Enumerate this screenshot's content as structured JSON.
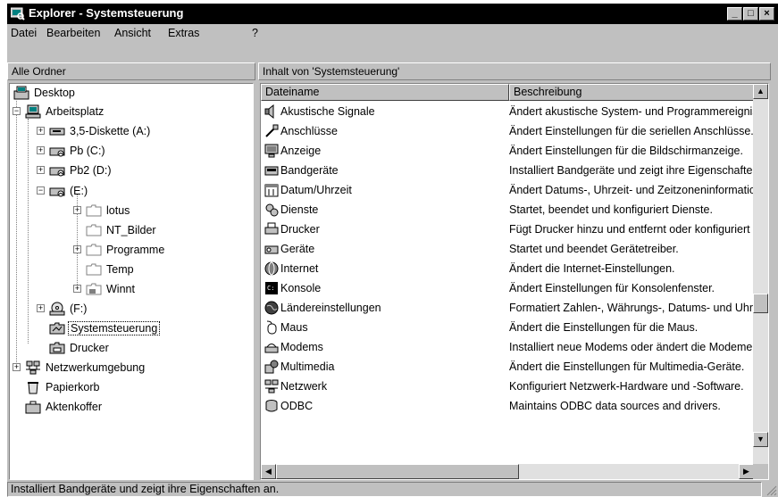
{
  "window": {
    "title": "Explorer - Systemsteuerung",
    "controls": {
      "minimize": "_",
      "maximize": "□",
      "close": "×"
    }
  },
  "menubar": [
    {
      "label": "Datei"
    },
    {
      "label": "Bearbeiten"
    },
    {
      "label": "Ansicht"
    },
    {
      "label": "Extras"
    },
    {
      "label": "?"
    }
  ],
  "left_pane": {
    "header": "Alle Ordner",
    "tree": [
      {
        "label": "Desktop",
        "icon": "desktop-icon",
        "expander": ""
      },
      {
        "label": "Arbeitsplatz",
        "icon": "computer-icon",
        "expander": "−"
      },
      {
        "label": "3,5-Diskette (A:)",
        "icon": "floppy-drive-icon",
        "expander": "+"
      },
      {
        "label": "Pb (C:)",
        "icon": "hard-drive-icon",
        "expander": "+"
      },
      {
        "label": "Pb2 (D:)",
        "icon": "hard-drive-icon",
        "expander": "+"
      },
      {
        "label": "(E:)",
        "icon": "hard-drive-icon",
        "expander": "−"
      },
      {
        "label": "lotus",
        "icon": "folder-icon",
        "expander": "+"
      },
      {
        "label": "NT_Bilder",
        "icon": "folder-icon",
        "expander": ""
      },
      {
        "label": "Programme",
        "icon": "folder-icon",
        "expander": "+"
      },
      {
        "label": "Temp",
        "icon": "folder-icon",
        "expander": ""
      },
      {
        "label": "Winnt",
        "icon": "folder-icon",
        "expander": "+"
      },
      {
        "label": "(F:)",
        "icon": "cd-drive-icon",
        "expander": "+"
      },
      {
        "label": "Systemsteuerung",
        "icon": "control-panel-icon",
        "expander": "",
        "selected": true
      },
      {
        "label": "Drucker",
        "icon": "printer-folder-icon",
        "expander": ""
      },
      {
        "label": "Netzwerkumgebung",
        "icon": "network-icon",
        "expander": "+"
      },
      {
        "label": "Papierkorb",
        "icon": "recycle-bin-icon",
        "expander": ""
      },
      {
        "label": "Aktenkoffer",
        "icon": "briefcase-icon",
        "expander": ""
      }
    ]
  },
  "right_pane": {
    "header": "Inhalt von 'Systemsteuerung'",
    "columns": {
      "name": "Dateiname",
      "description": "Beschreibung"
    },
    "rows": [
      {
        "name": "Akustische Signale",
        "desc": "Ändert akustische System- und Programmereignisse.",
        "icon": "sound-icon"
      },
      {
        "name": "Anschlüsse",
        "desc": "Ändert Einstellungen für die seriellen Anschlüsse.",
        "icon": "ports-icon"
      },
      {
        "name": "Anzeige",
        "desc": "Ändert Einstellungen für die Bildschirmanzeige.",
        "icon": "display-icon"
      },
      {
        "name": "Bandgeräte",
        "desc": "Installiert Bandgeräte und zeigt ihre Eigenschaften an.",
        "icon": "tape-device-icon"
      },
      {
        "name": "Datum/Uhrzeit",
        "desc": "Ändert Datums-, Uhrzeit- und Zeitzoneninformationen.",
        "icon": "date-time-icon"
      },
      {
        "name": "Dienste",
        "desc": "Startet, beendet und konfiguriert Dienste.",
        "icon": "services-icon"
      },
      {
        "name": "Drucker",
        "desc": "Fügt Drucker hinzu und entfernt oder konfiguriert sie.",
        "icon": "printer-icon"
      },
      {
        "name": "Geräte",
        "desc": "Startet und beendet Gerätetreiber.",
        "icon": "devices-icon"
      },
      {
        "name": "Internet",
        "desc": "Ändert die Internet-Einstellungen.",
        "icon": "internet-icon"
      },
      {
        "name": "Konsole",
        "desc": "Ändert Einstellungen für Konsolenfenster.",
        "icon": "console-icon"
      },
      {
        "name": "Ländereinstellungen",
        "desc": "Formatiert Zahlen-, Währungs-, Datums- und Uhrzeitangaben.",
        "icon": "regional-settings-icon"
      },
      {
        "name": "Maus",
        "desc": "Ändert die Einstellungen für die Maus.",
        "icon": "mouse-icon"
      },
      {
        "name": "Modems",
        "desc": "Installiert neue Modems oder ändert die Modemeigenschaften.",
        "icon": "modem-icon"
      },
      {
        "name": "Multimedia",
        "desc": "Ändert die Einstellungen für Multimedia-Geräte.",
        "icon": "multimedia-icon"
      },
      {
        "name": "Netzwerk",
        "desc": "Konfiguriert Netzwerk-Hardware und -Software.",
        "icon": "network-icon"
      },
      {
        "name": "ODBC",
        "desc": "Maintains ODBC data sources and drivers.",
        "icon": "odbc-icon"
      }
    ]
  },
  "statusbar": {
    "text": "Installiert Bandgeräte und zeigt ihre Eigenschaften an."
  }
}
